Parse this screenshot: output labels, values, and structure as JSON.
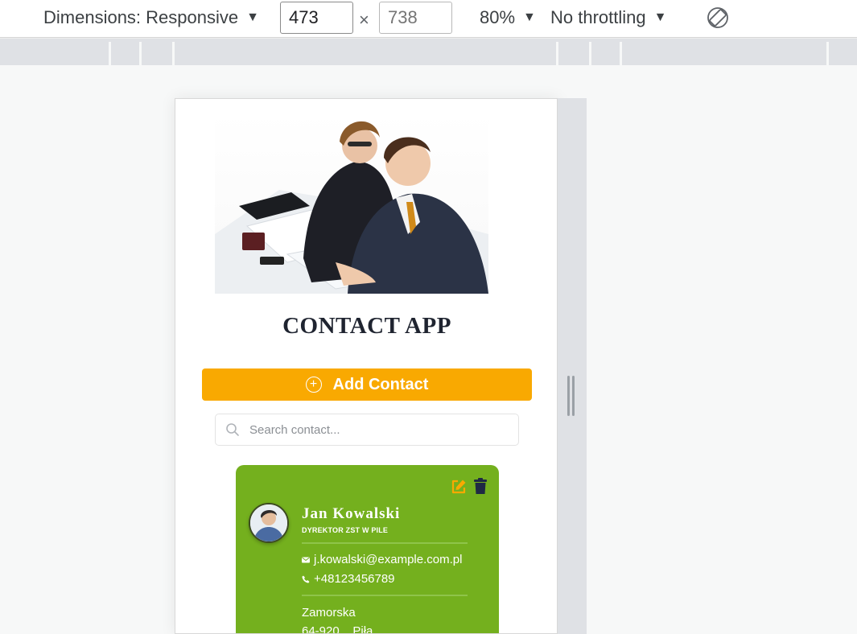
{
  "toolbar": {
    "dimensions_label": "Dimensions: Responsive",
    "width_value": "473",
    "height_placeholder": "738",
    "times_symbol": "×",
    "zoom": "80%",
    "throttling": "No throttling",
    "caret": "▼"
  },
  "app": {
    "title": "CONTACT APP",
    "add_button_label": "Add Contact",
    "search_placeholder": "Search contact..."
  },
  "contact": {
    "name": "Jan Kowalski",
    "role": "DYREKTOR ZST W PILE",
    "email": "j.kowalski@example.com.pl",
    "phone": "+48123456789",
    "street": "Zamorska",
    "city": "64-920    Piła"
  },
  "colors": {
    "accent": "#f9a901",
    "card": "#74b01e",
    "edit_icon": "#f9a901",
    "delete_icon": "#1f2a44"
  },
  "icons": [
    "caret-down-icon",
    "rotate-icon",
    "plus-circle-icon",
    "search-icon",
    "edit-icon",
    "trash-icon",
    "mail-icon",
    "phone-icon"
  ]
}
